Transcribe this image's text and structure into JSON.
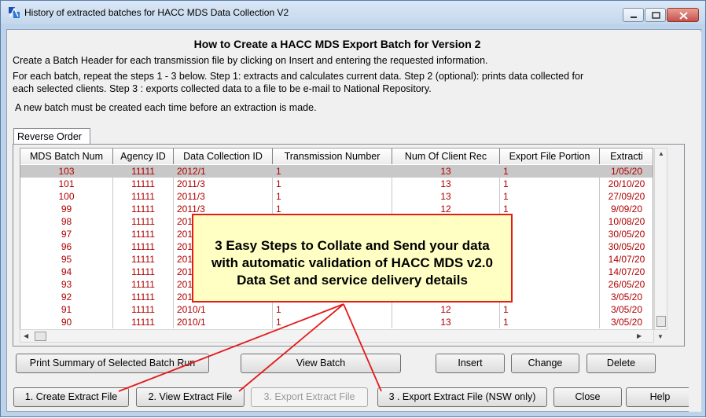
{
  "window": {
    "title": "History of extracted batches for HACC MDS Data Collection V2"
  },
  "instructions": {
    "heading": "How to Create a HACC MDS Export Batch for Version 2",
    "line1": "Create a Batch Header for each transmission  file by clicking on Insert and entering the requested information.",
    "line2a": "For each batch, repeat the steps 1 - 3 below.  Step 1: extracts and calculates current data.  Step 2 (optional): prints data collected for",
    "line2b": "each selected clients. Step 3 : exports collected data to a file to be e-mail to National Repository.",
    "line3": "A new batch must be created each time before an extraction is made."
  },
  "tab": {
    "label": "Reverse Order"
  },
  "grid": {
    "columns": [
      "MDS Batch Num",
      "Agency ID",
      "Data Collection ID",
      "Transmission Number",
      "Num Of Client Rec",
      "Export File Portion",
      "Extracti"
    ],
    "rows": [
      {
        "batch": "103",
        "agency": "11111",
        "dcid": "2012/1",
        "trans": "1",
        "clients": "13",
        "portion": "1",
        "extract": "1/05/20"
      },
      {
        "batch": "101",
        "agency": "11111",
        "dcid": "2011/3",
        "trans": "1",
        "clients": "13",
        "portion": "1",
        "extract": "20/10/20"
      },
      {
        "batch": "100",
        "agency": "11111",
        "dcid": "2011/3",
        "trans": "1",
        "clients": "13",
        "portion": "1",
        "extract": "27/09/20"
      },
      {
        "batch": "99",
        "agency": "11111",
        "dcid": "2011/3",
        "trans": "1",
        "clients": "12",
        "portion": "1",
        "extract": "9/09/20"
      },
      {
        "batch": "98",
        "agency": "11111",
        "dcid": "201",
        "trans": "",
        "clients": "",
        "portion": "",
        "extract": "10/08/20"
      },
      {
        "batch": "97",
        "agency": "11111",
        "dcid": "201",
        "trans": "",
        "clients": "",
        "portion": "",
        "extract": "30/05/20"
      },
      {
        "batch": "96",
        "agency": "11111",
        "dcid": "201",
        "trans": "",
        "clients": "",
        "portion": "",
        "extract": "30/05/20"
      },
      {
        "batch": "95",
        "agency": "11111",
        "dcid": "201",
        "trans": "",
        "clients": "",
        "portion": "",
        "extract": "14/07/20"
      },
      {
        "batch": "94",
        "agency": "11111",
        "dcid": "201",
        "trans": "",
        "clients": "",
        "portion": "",
        "extract": "14/07/20"
      },
      {
        "batch": "93",
        "agency": "11111",
        "dcid": "201",
        "trans": "",
        "clients": "",
        "portion": "",
        "extract": "26/05/20"
      },
      {
        "batch": "92",
        "agency": "11111",
        "dcid": "201",
        "trans": "",
        "clients": "",
        "portion": "",
        "extract": "3/05/20"
      },
      {
        "batch": "91",
        "agency": "11111",
        "dcid": "2010/1",
        "trans": "1",
        "clients": "12",
        "portion": "1",
        "extract": "3/05/20"
      },
      {
        "batch": "90",
        "agency": "11111",
        "dcid": "2010/1",
        "trans": "1",
        "clients": "13",
        "portion": "1",
        "extract": "3/05/20"
      }
    ],
    "selected_row": 0
  },
  "buttons": {
    "print_summary": "Print Summary of Selected Batch Run",
    "view_batch": "View Batch",
    "insert": "Insert",
    "change": "Change",
    "delete": "Delete",
    "create_extract": "1. Create Extract File",
    "view_extract": "2. View Extract File",
    "export_extract": "3. Export Extract File",
    "export_nsw": "3 . Export Extract File (NSW only)",
    "close": "Close",
    "help": "Help"
  },
  "callout": {
    "line1": "3 Easy Steps to Collate and Send your data",
    "line2": "with automatic validation of HACC MDS v2.0",
    "line3": "Data Set and service delivery details"
  },
  "colors": {
    "row_text": "#b00000",
    "callout_border": "#e31b1b",
    "callout_fill": "#ffffc4"
  }
}
